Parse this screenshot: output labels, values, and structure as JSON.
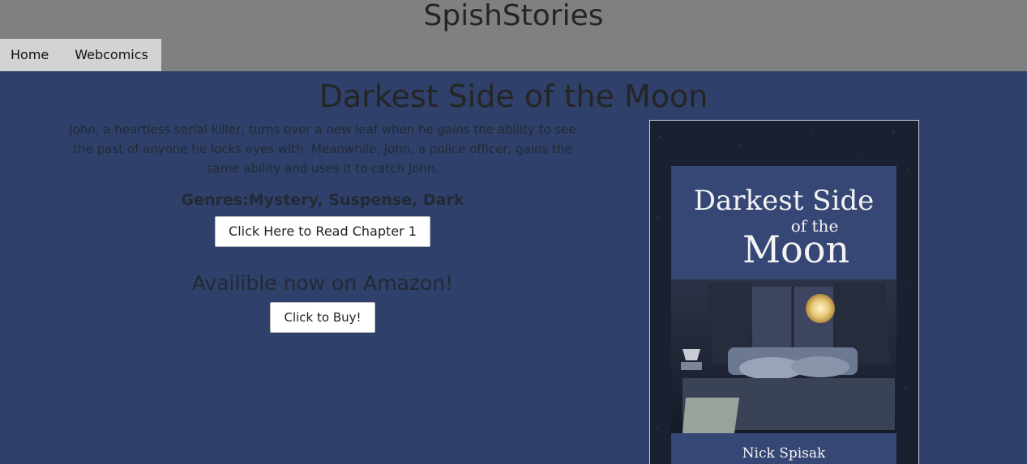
{
  "site": {
    "title": "SpishStories"
  },
  "nav": {
    "items": [
      {
        "label": "Home"
      },
      {
        "label": "Webcomics"
      }
    ]
  },
  "book": {
    "title": "Darkest Side of the Moon",
    "synopsis": "John, a heartless serial killer, turns over a new leaf when he gains the ability to see the past of anyone he locks eyes with. Meanwhile, John, a police officer, gains the same ability and uses it to catch John.",
    "genres": "Genres:Mystery, Suspense, Dark",
    "read_button": "Click Here to Read Chapter 1",
    "amazon_heading": "Availible now on Amazon!",
    "buy_button": "Click to Buy!",
    "cover": {
      "title_line1": "Darkest Side",
      "title_line2": "of the",
      "title_line3": "Moon",
      "author": "Nick Spisak"
    }
  },
  "colors": {
    "page_bg": "#2f416a",
    "header_bg": "#808080",
    "nav_bg": "#d3d3d3"
  }
}
